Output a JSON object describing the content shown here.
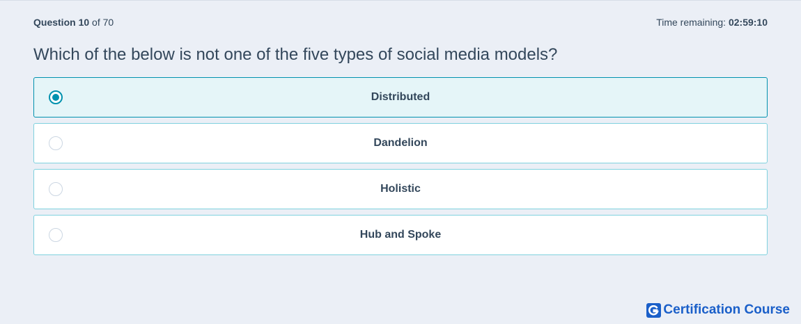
{
  "header": {
    "question_label": "Question",
    "question_number": "10",
    "question_of": "of 70",
    "time_label": "Time remaining:",
    "time_value": "02:59:10"
  },
  "question": {
    "text": "Which of the below is not one of the five types of social media models?"
  },
  "options": [
    {
      "label": "Distributed",
      "selected": true
    },
    {
      "label": "Dandelion",
      "selected": false
    },
    {
      "label": "Holistic",
      "selected": false
    },
    {
      "label": "Hub and Spoke",
      "selected": false
    }
  ],
  "brand": {
    "name": "Certification Course",
    "color": "#1a5fc9"
  },
  "colors": {
    "accent": "#0091ae",
    "border": "#7fd1de",
    "selected_bg": "#e5f5f8",
    "page_bg": "#ebeff6"
  }
}
